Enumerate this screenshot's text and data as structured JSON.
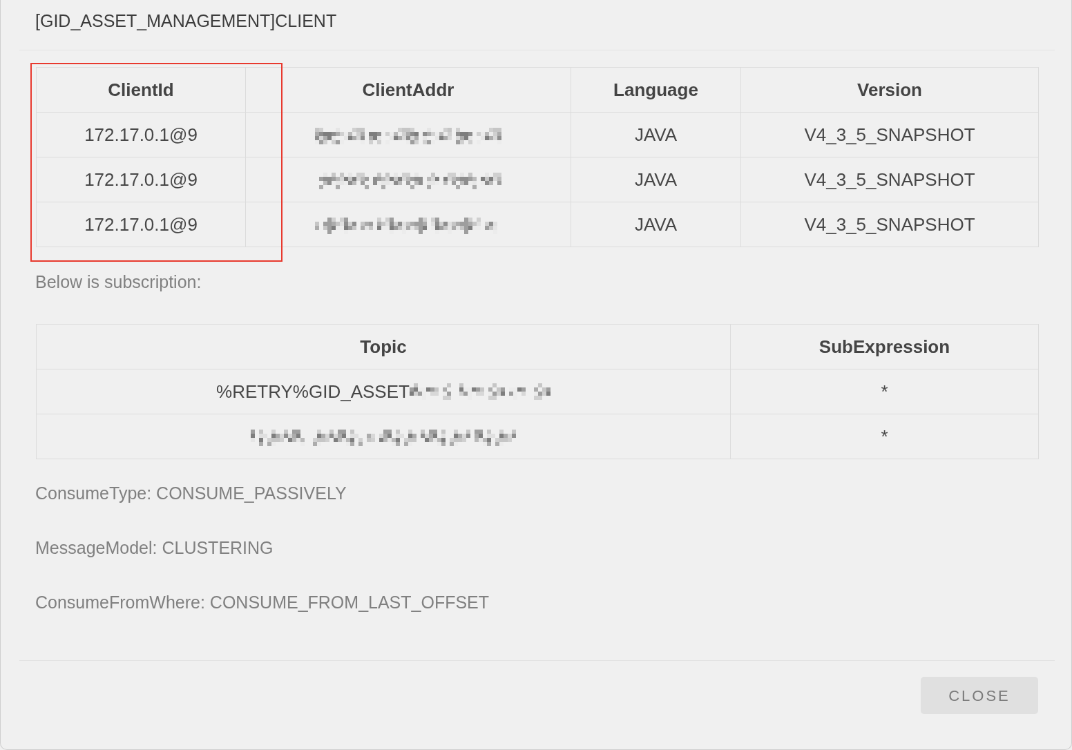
{
  "dialog": {
    "title": "[GID_ASSET_MANAGEMENT]CLIENT"
  },
  "client_table": {
    "columns": [
      {
        "label": "ClientId",
        "highlighted": true
      },
      {
        "label": "ClientAddr",
        "highlighted": false
      },
      {
        "label": "Language",
        "highlighted": false
      },
      {
        "label": "Version",
        "highlighted": false
      }
    ],
    "rows": [
      [
        {
          "kind": "text",
          "text": "172.17.0.1@9"
        },
        {
          "kind": "redacted"
        },
        {
          "kind": "text",
          "text": "JAVA"
        },
        {
          "kind": "text",
          "text": "V4_3_5_SNAPSHOT"
        }
      ],
      [
        {
          "kind": "text",
          "text": "172.17.0.1@9"
        },
        {
          "kind": "redacted"
        },
        {
          "kind": "text",
          "text": "JAVA"
        },
        {
          "kind": "text",
          "text": "V4_3_5_SNAPSHOT"
        }
      ],
      [
        {
          "kind": "text",
          "text": "172.17.0.1@9"
        },
        {
          "kind": "redacted"
        },
        {
          "kind": "text",
          "text": "JAVA"
        },
        {
          "kind": "text",
          "text": "V4_3_5_SNAPSHOT"
        }
      ]
    ]
  },
  "subscription_label": "Below is subscription:",
  "subscription_table": {
    "columns": [
      {
        "label": "Topic"
      },
      {
        "label": "SubExpression"
      }
    ],
    "rows": [
      [
        {
          "kind": "partly_redacted",
          "text": "%RETRY%GID_ASSET"
        },
        {
          "kind": "text",
          "text": "*"
        }
      ],
      [
        {
          "kind": "redacted"
        },
        {
          "kind": "text",
          "text": "*"
        }
      ]
    ]
  },
  "properties": [
    "ConsumeType: CONSUME_PASSIVELY",
    "MessageModel: CLUSTERING",
    "ConsumeFromWhere: CONSUME_FROM_LAST_OFFSET"
  ],
  "buttons": [
    {
      "label": "CLOSE"
    }
  ]
}
